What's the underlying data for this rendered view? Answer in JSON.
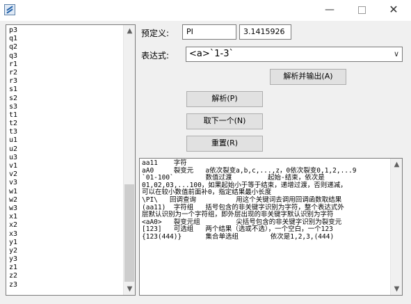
{
  "titlebar": {
    "icon": "app-icon",
    "minimize": "—",
    "maximize": "",
    "close": "✕"
  },
  "list": {
    "items": [
      "p3",
      "q1",
      "q2",
      "q3",
      "r1",
      "r2",
      "r3",
      "s1",
      "s2",
      "s3",
      "t1",
      "t2",
      "t3",
      "u1",
      "u2",
      "u3",
      "v1",
      "v2",
      "v3",
      "w1",
      "w2",
      "w3",
      "x1",
      "x2",
      "x3",
      "y1",
      "y2",
      "y3",
      "z1",
      "z2",
      "z3"
    ],
    "scroll_up": "▲",
    "scroll_down": "▼"
  },
  "predef": {
    "label": "预定义:",
    "name": "PI",
    "value": "3.1415926"
  },
  "expr": {
    "label": "表达式:",
    "value": "<a>`1-3`",
    "arrow": "∨"
  },
  "buttons": {
    "parse_output": "解析并输出(A)",
    "parse": "解析(P)",
    "next": "取下一个(N)",
    "reset": "重置(R)"
  },
  "memo": {
    "lines": [
      "aa11    字符",
      "aA0     裂变元   a依次裂变a,b,c,...,z，0依次裂变0,1,2,...9",
      "`01-100`        数值过渡         起始-结束，依次是",
      "01,02,03,...100，如果起始小于等于结束，递增过渡，否则递减，",
      "可以在较小数值前面补0，指定结果最小长度",
      "\\PI\\   回调查询          用这个关键词去调用回调函数取结果",
      "(aa11)  字符组   括号包含的非关键字识别为字符，整个表达式外",
      "层默认识别为一个字符组，即外层出现的非关键字默认识别为字符",
      "<aA0>   裂变元组         尖括号包含的非关键字识别为裂变元",
      "[123]   可选组   两个结果（选或不选），一个空白，一个123",
      "{123(444)}      集合单选组        依次是1,2,3,(444)"
    ],
    "scroll_up": "▲",
    "scroll_down": "▼"
  }
}
